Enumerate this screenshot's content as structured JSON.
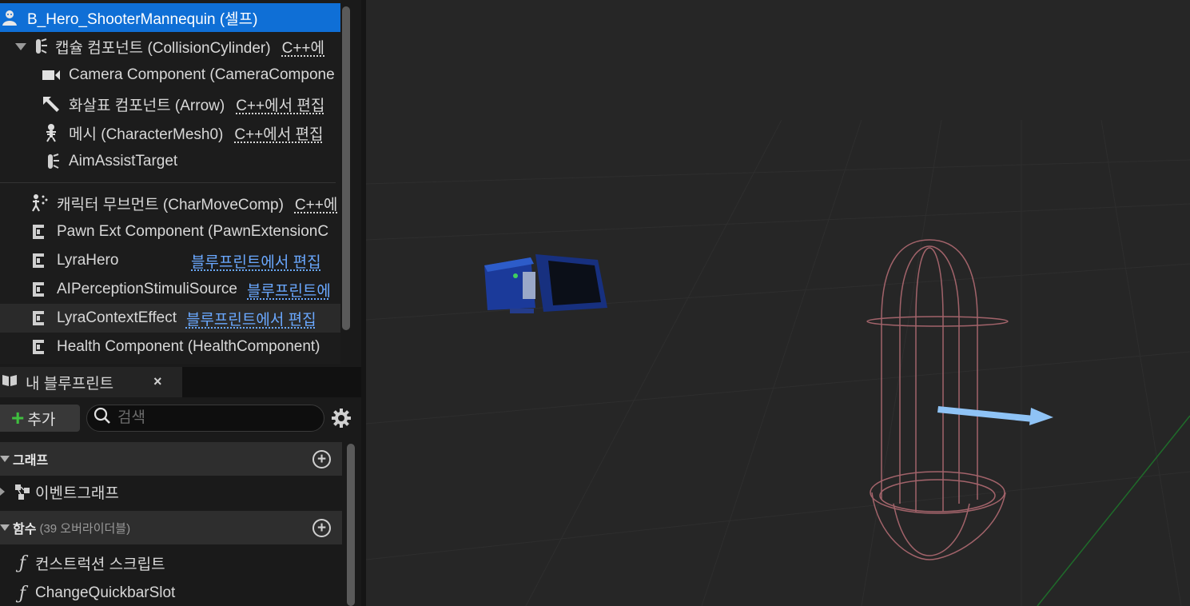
{
  "components": {
    "items": [
      {
        "name": "B_Hero_ShooterMannequin (셀프)",
        "edit": ""
      },
      {
        "name": "캡슐 컴포넌트 (CollisionCylinder)",
        "edit": "C++에"
      },
      {
        "name": "Camera Component (CameraCompone",
        "edit": ""
      },
      {
        "name": "화살표 컴포넌트 (Arrow)",
        "edit": "C++에서 편집"
      },
      {
        "name": "메시 (CharacterMesh0)",
        "edit": "C++에서 편집"
      },
      {
        "name": "AimAssistTarget",
        "edit": ""
      },
      {
        "name": "캐릭터 무브먼트 (CharMoveComp)",
        "edit": "C++에"
      },
      {
        "name": "Pawn Ext Component (PawnExtensionC",
        "edit": ""
      },
      {
        "name": "LyraHero",
        "edit": "블루프린트에서 편집"
      },
      {
        "name": "AIPerceptionStimuliSource",
        "edit": "블루프린트에"
      },
      {
        "name": "LyraContextEffect",
        "edit": "블루프린트에서 편집"
      },
      {
        "name": "Health Component (HealthComponent)",
        "edit": ""
      }
    ]
  },
  "my_blueprint": {
    "tab_label": "내 블루프린트",
    "close_label": "×",
    "add_label": "추가",
    "search_placeholder": "검색",
    "sections": {
      "graph": {
        "title": "그래프",
        "items": [
          "이벤트그래프"
        ]
      },
      "functions": {
        "title": "함수",
        "subtitle": "(39 오버라이더블)",
        "items": [
          "컨스트럭션 스크립트",
          "ChangeQuickbarSlot"
        ]
      }
    }
  },
  "colors": {
    "selection": "#0f6fd6",
    "blueprint_link": "#6aa8ff",
    "add_plus": "#3fbf3f",
    "capsule_wire": "#b06a72",
    "arrow": "#8fc3f5",
    "camera": "#1b3a9a"
  }
}
